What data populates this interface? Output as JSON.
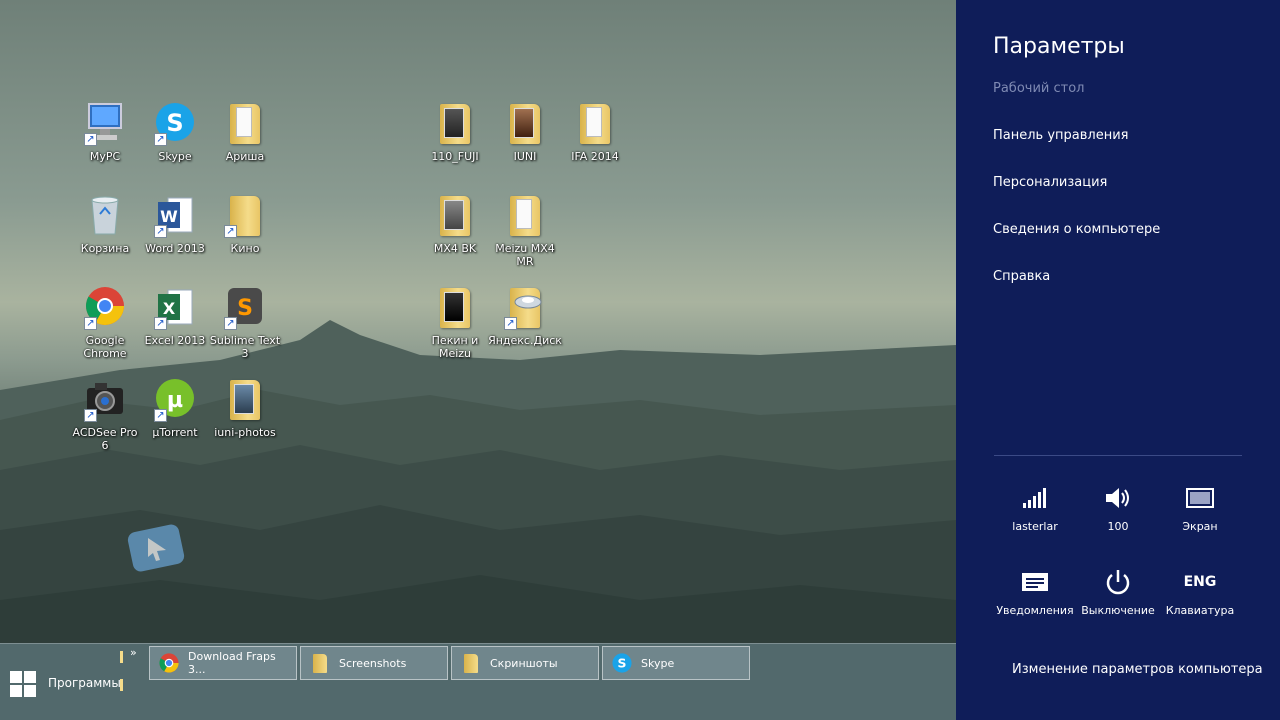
{
  "desktop": {
    "icons": [
      {
        "label": "MyPC",
        "icon": "computer-icon"
      },
      {
        "label": "Skype",
        "icon": "skype-icon"
      },
      {
        "label": "Ариша",
        "icon": "folder-icon"
      },
      {
        "label": "Корзина",
        "icon": "recycle-bin-icon"
      },
      {
        "label": "Word 2013",
        "icon": "word-icon"
      },
      {
        "label": "Кино",
        "icon": "folder-icon"
      },
      {
        "label": "Google Chrome",
        "icon": "chrome-icon"
      },
      {
        "label": "Excel 2013",
        "icon": "excel-icon"
      },
      {
        "label": "Sublime Text 3",
        "icon": "sublime-icon"
      },
      {
        "label": "ACDSee Pro 6",
        "icon": "camera-icon"
      },
      {
        "label": "µTorrent",
        "icon": "utorrent-icon"
      },
      {
        "label": "iuni-photos",
        "icon": "folder-icon"
      },
      {
        "label": "110_FUJI",
        "icon": "folder-icon"
      },
      {
        "label": "IUNI",
        "icon": "folder-icon"
      },
      {
        "label": "IFA 2014",
        "icon": "folder-icon"
      },
      {
        "label": "MX4 BK",
        "icon": "folder-icon"
      },
      {
        "label": "Meizu MX4 MR",
        "icon": "folder-icon"
      },
      {
        "label": "Пекин и Meizu",
        "icon": "folder-icon"
      },
      {
        "label": "Яндекс.Диск",
        "icon": "yandex-disk-icon"
      }
    ]
  },
  "taskbar": {
    "programs_label": "Программы",
    "more_glyph": "»",
    "buttons": [
      {
        "label": "Download Fraps 3...",
        "icon": "chrome-icon"
      },
      {
        "label": "Screenshots",
        "icon": "folder-icon"
      },
      {
        "label": "Скриншоты",
        "icon": "folder-icon"
      },
      {
        "label": "Skype",
        "icon": "skype-icon"
      }
    ]
  },
  "charm": {
    "title": "Параметры",
    "subtitle": "Рабочий стол",
    "links": [
      "Панель управления",
      "Персонализация",
      "Сведения о компьютере",
      "Справка"
    ],
    "tiles": [
      {
        "label": "lasterlar",
        "icon": "network-signal-icon"
      },
      {
        "label": "100",
        "icon": "volume-icon"
      },
      {
        "label": "Экран",
        "icon": "screen-icon"
      },
      {
        "label": "Уведомления",
        "icon": "notifications-icon"
      },
      {
        "label": "Выключение",
        "icon": "power-icon"
      },
      {
        "label": "Клавиатура",
        "icon": "keyboard-icon",
        "glyph": "ENG"
      }
    ],
    "bottom_link": "Изменение параметров компьютера"
  },
  "colors": {
    "charm_bg": "#0f1d59",
    "charm_subtitle": "#7f8ab3"
  }
}
